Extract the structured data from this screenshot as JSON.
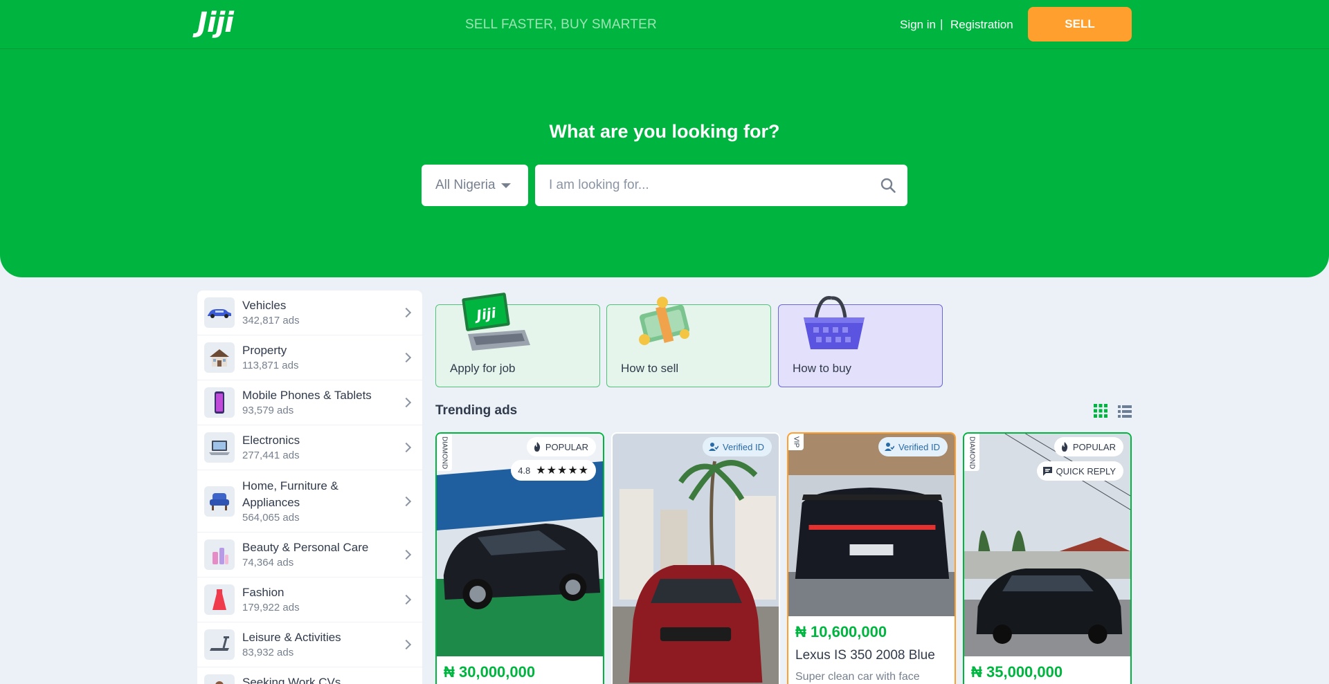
{
  "header": {
    "logo": "Jiji",
    "tagline": "SELL FASTER, BUY SMARTER",
    "sign_in": "Sign in",
    "separator": "|",
    "registration": "Registration",
    "sell": "SELL"
  },
  "hero": {
    "title": "What are you looking for?",
    "location": "All Nigeria",
    "search_placeholder": "I am looking for..."
  },
  "categories": [
    {
      "name": "Vehicles",
      "count": "342,817 ads"
    },
    {
      "name": "Property",
      "count": "113,871 ads"
    },
    {
      "name": "Mobile Phones & Tablets",
      "count": "93,579 ads"
    },
    {
      "name": "Electronics",
      "count": "277,441 ads"
    },
    {
      "name": "Home, Furniture & Appliances",
      "count": "564,065 ads"
    },
    {
      "name": "Beauty & Personal Care",
      "count": "74,364 ads"
    },
    {
      "name": "Fashion",
      "count": "179,922 ads"
    },
    {
      "name": "Leisure & Activities",
      "count": "83,932 ads"
    },
    {
      "name": "Seeking Work CVs",
      "count": ""
    }
  ],
  "tiles": {
    "apply": "Apply for job",
    "sell": "How to sell",
    "buy": "How to buy"
  },
  "trending": {
    "title": "Trending ads",
    "ads": [
      {
        "tier": "DIAMOND",
        "badge": "POPULAR",
        "rating": "4.8",
        "stars": "★★★★★",
        "price": "₦ 30,000,000"
      },
      {
        "badge": "Verified ID"
      },
      {
        "tier": "VIP",
        "badge": "Verified ID",
        "price": "₦ 10,600,000",
        "title": "Lexus IS 350 2008 Blue",
        "desc": "Super clean car with face"
      },
      {
        "tier": "DIAMOND",
        "badge": "POPULAR",
        "badge2": "QUICK REPLY",
        "price": "₦ 35,000,000"
      }
    ]
  },
  "colors": {
    "brand_green": "#00b53f",
    "sell_orange": "#ff9f2d",
    "background": "#ebf1f7"
  }
}
